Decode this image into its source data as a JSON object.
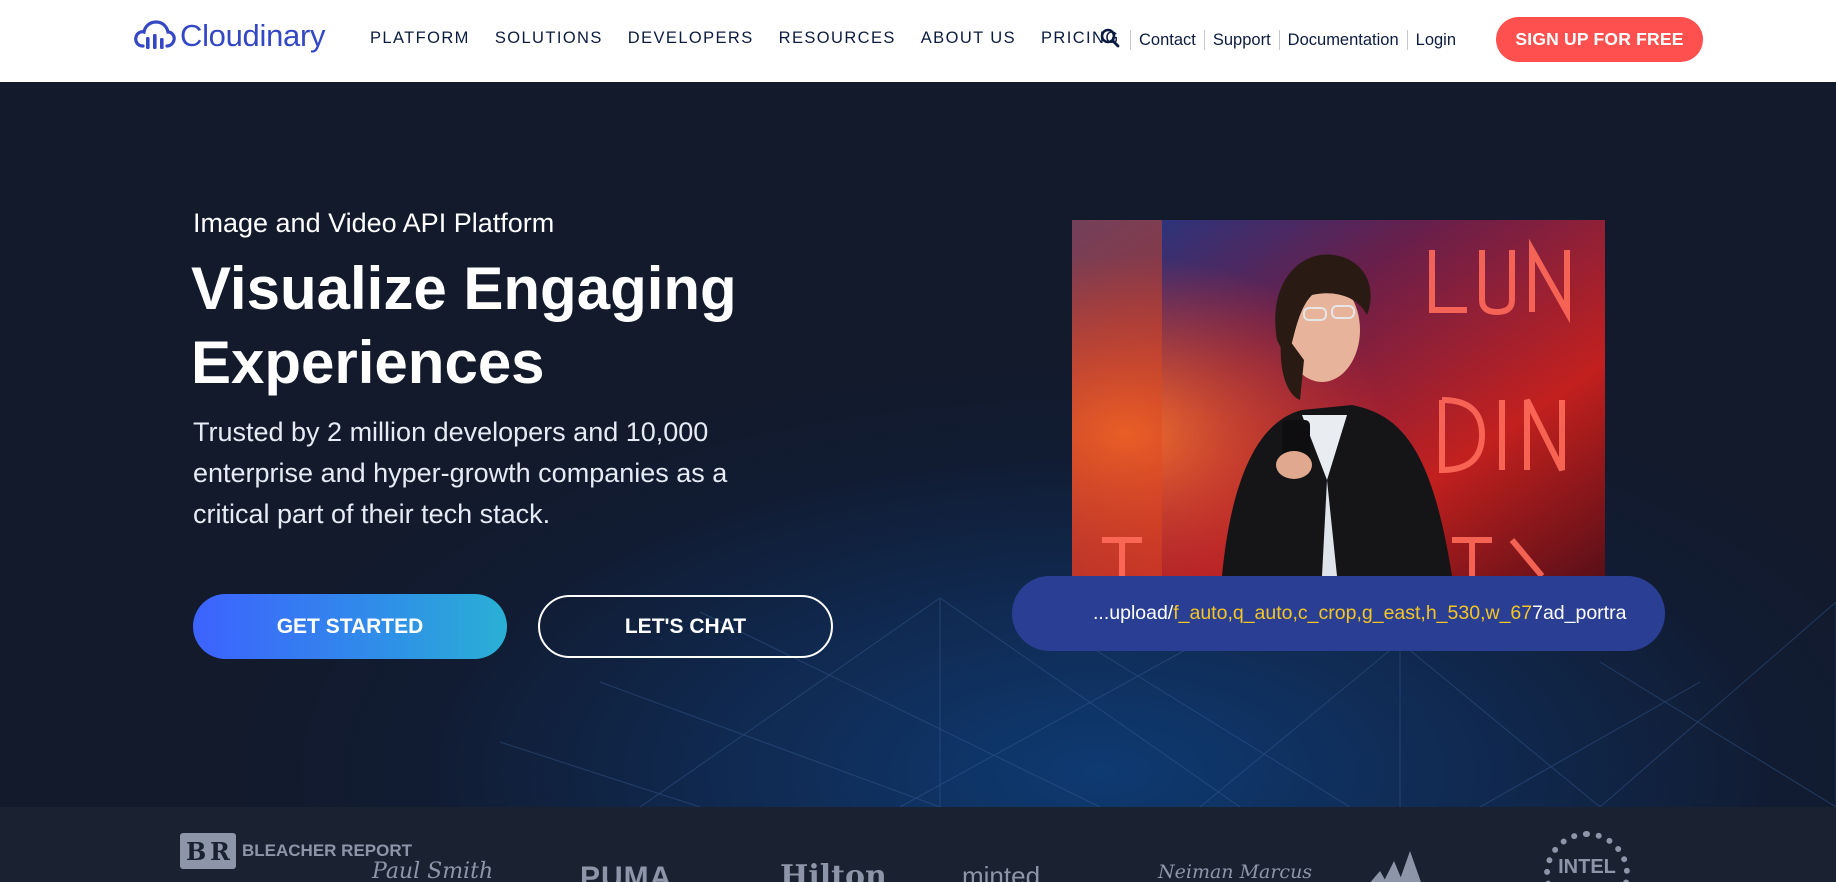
{
  "header": {
    "logo_text": "Cloudinary",
    "nav": [
      "PLATFORM",
      "SOLUTIONS",
      "DEVELOPERS",
      "RESOURCES",
      "ABOUT US",
      "PRICING"
    ],
    "util_links": [
      "Contact",
      "Support",
      "Documentation",
      "Login"
    ],
    "signup_label": "SIGN UP FOR FREE"
  },
  "hero": {
    "eyebrow": "Image and Video API Platform",
    "headline_line1": "Visualize Engaging",
    "headline_line2": "Experiences",
    "subcopy": "Trusted by 2 million developers and 10,000 enterprise and hyper-growth companies as a critical part of their tech stack.",
    "get_started_label": "GET STARTED",
    "lets_chat_label": "LET'S CHAT",
    "url_prefix": "...upload/",
    "url_params": "f_auto,q_auto,c_crop,g_east,h_530,w_67",
    "url_suffix": "7ad_portra"
  },
  "brands": [
    "BLEACHER REPORT",
    "Paul Smith",
    "PUMA",
    "Hilton",
    "minted",
    "Neiman Marcus",
    "adidas",
    "INTEL"
  ],
  "colors": {
    "brand_blue": "#3448c5",
    "signup_red": "#ff5050",
    "hero_bg": "#121a2b",
    "url_param_yellow": "#f5c623"
  }
}
